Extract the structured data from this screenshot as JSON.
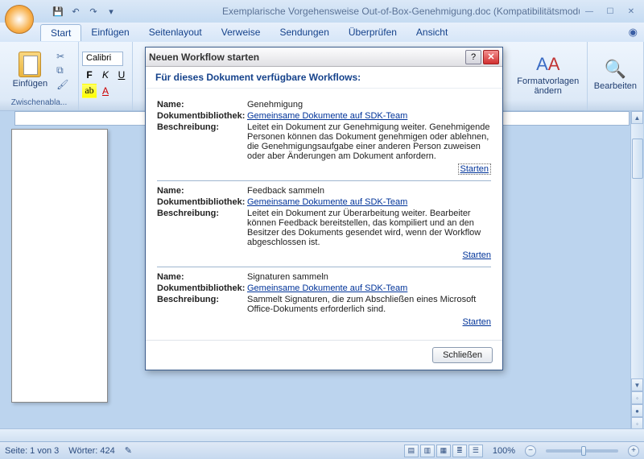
{
  "titlebar": {
    "doc_title": "Exemplarische Vorgehensweise Out-of-Box-Genehmigung.doc (Kompatibilitätsmodus) - M..."
  },
  "menu": {
    "tabs": [
      "Start",
      "Einfügen",
      "Seitenlayout",
      "Verweise",
      "Sendungen",
      "Überprüfen",
      "Ansicht"
    ]
  },
  "ribbon": {
    "paste": "Einfügen",
    "clipboard": "Zwischenabla...",
    "font_name": "Calibri",
    "styles": "Formatvorlagen ändern",
    "edit": "Bearbeiten"
  },
  "dialog": {
    "title": "Neuen Workflow starten",
    "header": "Für dieses Dokument verfügbare Workflows:",
    "lbl_name": "Name:",
    "lbl_lib": "Dokumentbibliothek:",
    "lbl_desc": "Beschreibung:",
    "lib_link": "Gemeinsame Dokumente auf SDK-Team",
    "start": "Starten",
    "close": "Schließen",
    "workflows": [
      {
        "name": "Genehmigung",
        "desc": "Leitet ein Dokument zur Genehmigung weiter. Genehmigende Personen können das Dokument genehmigen oder ablehnen, die Genehmigungsaufgabe einer anderen Person zuweisen oder aber Änderungen am Dokument anfordern."
      },
      {
        "name": "Feedback sammeln",
        "desc": "Leitet ein Dokument zur Überarbeitung weiter. Bearbeiter können Feedback bereitstellen, das kompiliert und an den Besitzer des Dokuments gesendet wird, wenn der Workflow abgeschlossen ist."
      },
      {
        "name": "Signaturen sammeln",
        "desc": "Sammelt Signaturen, die zum Abschließen eines Microsoft Office-Dokuments erforderlich sind."
      }
    ]
  },
  "status": {
    "page": "Seite: 1 von 3",
    "words": "Wörter: 424",
    "zoom": "100%"
  }
}
